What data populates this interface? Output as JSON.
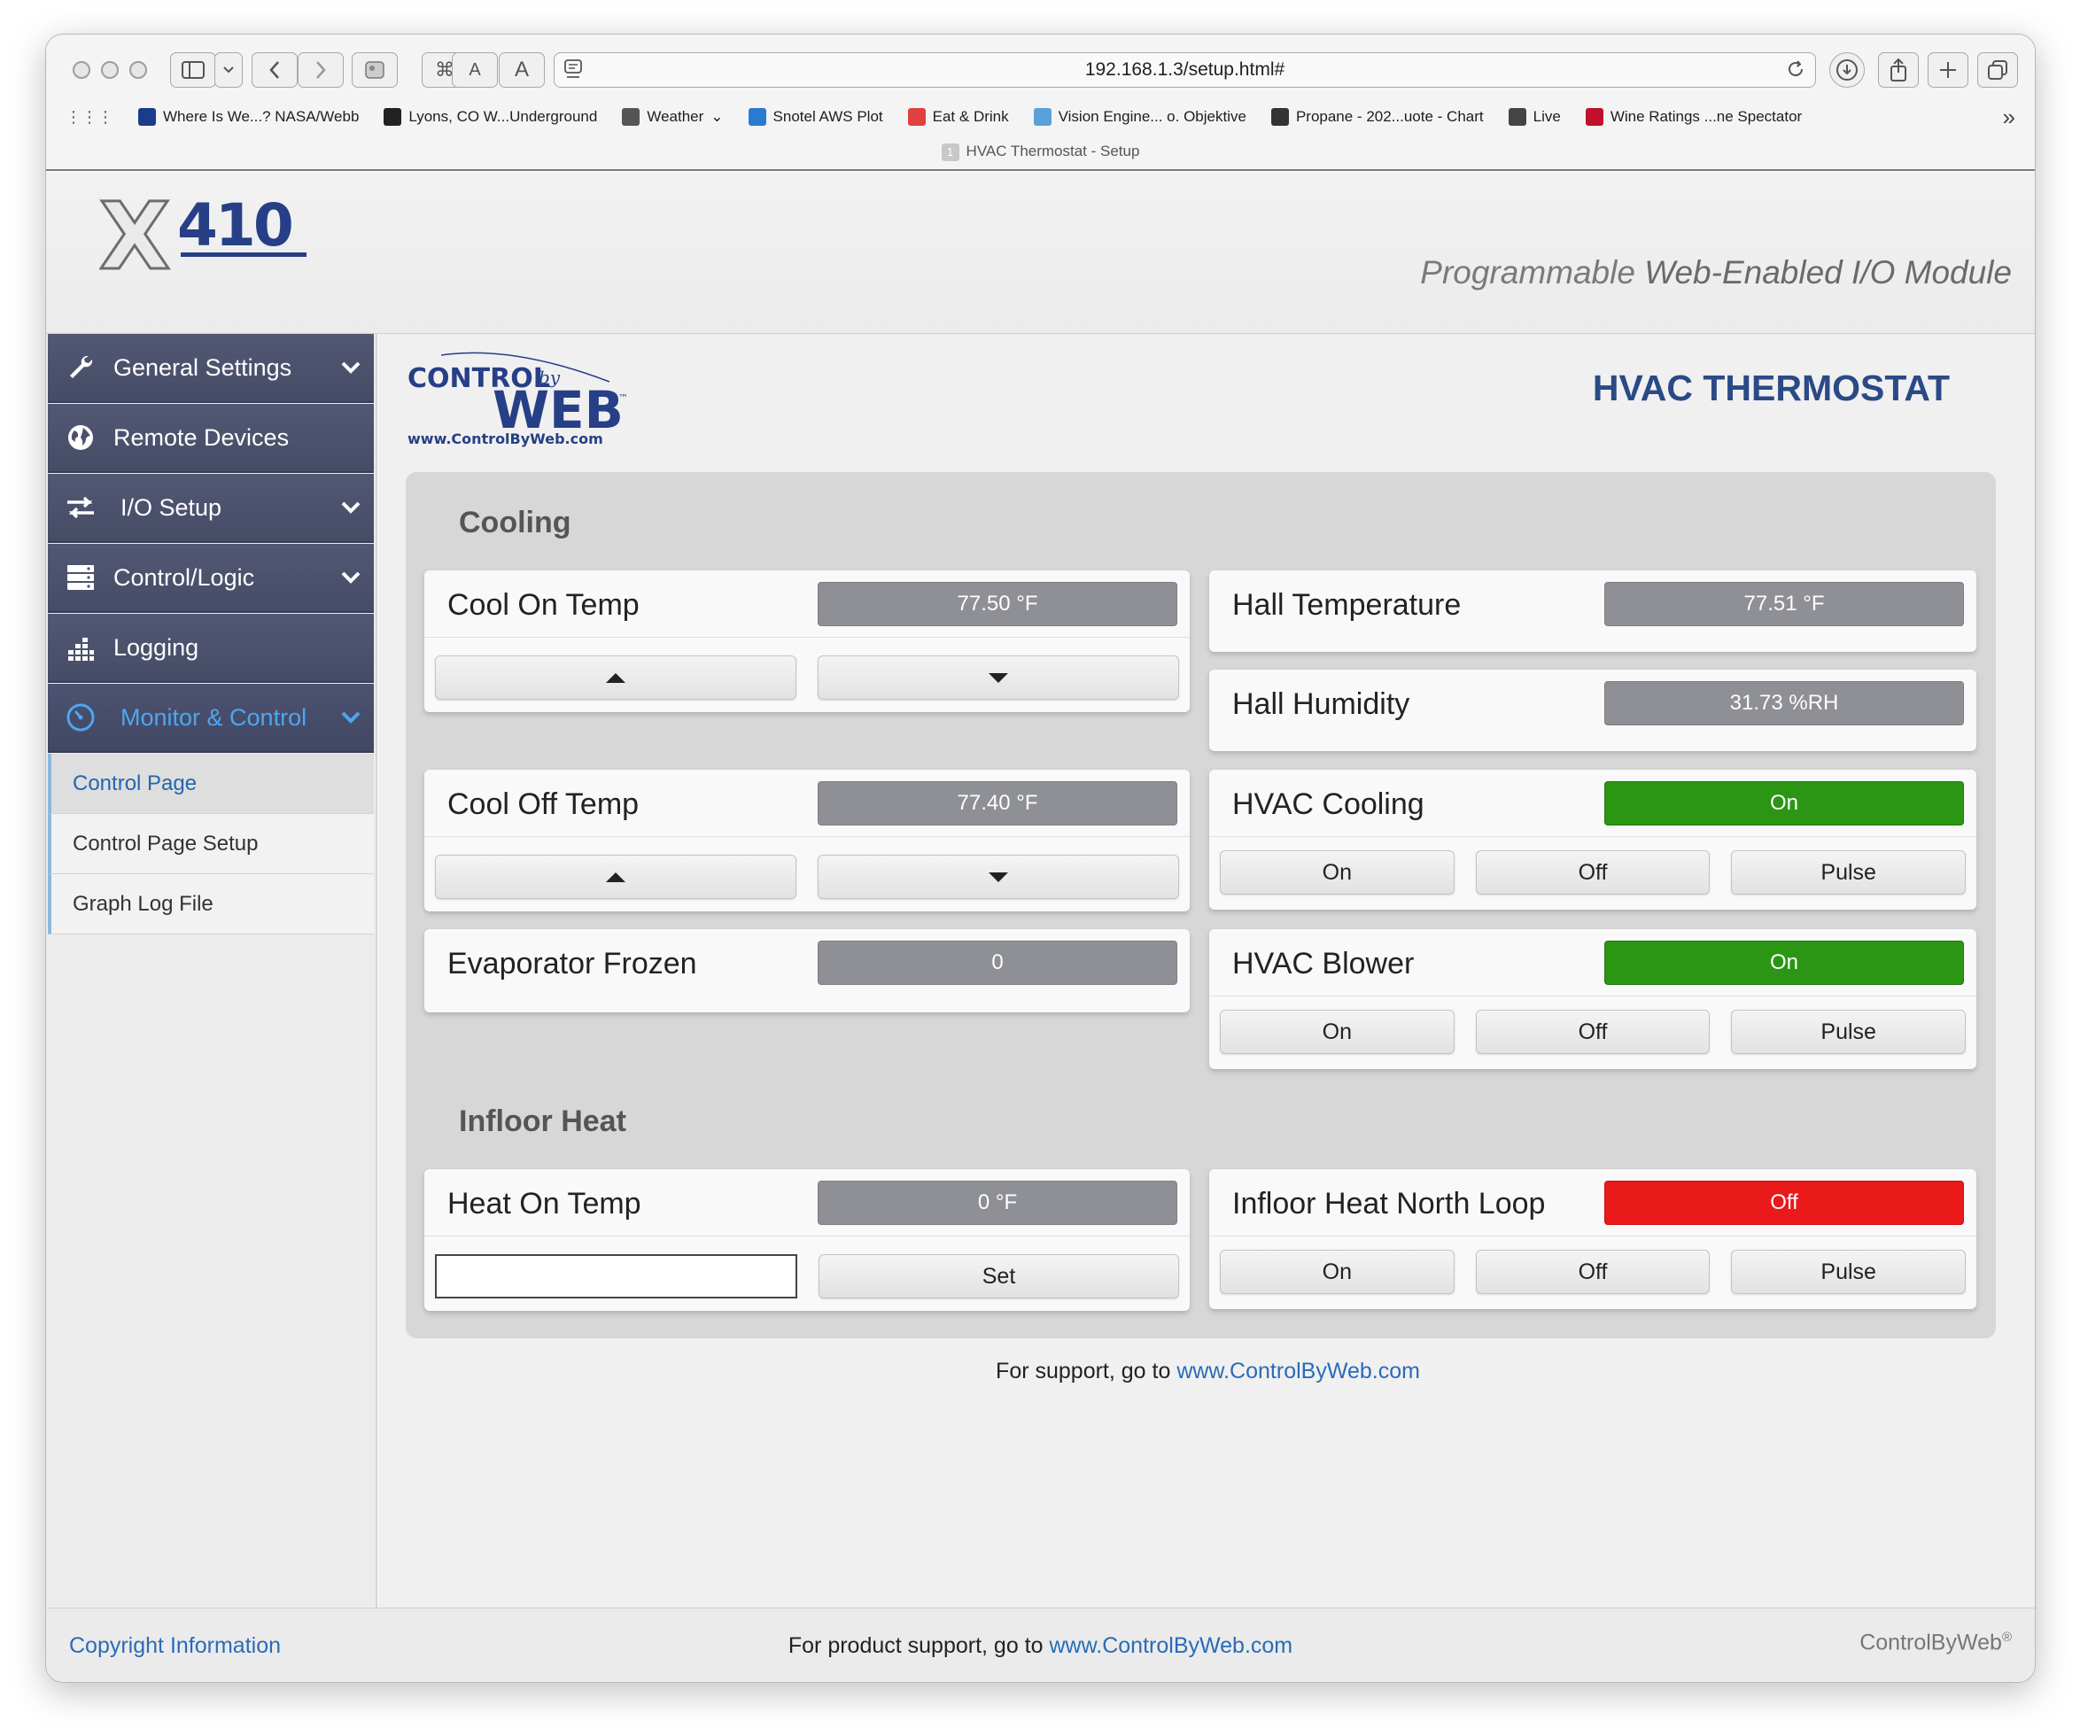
{
  "browser": {
    "url": "192.168.1.3/setup.html#",
    "tab_title": "HVAC Thermostat - Setup",
    "tab_number": "1",
    "text_size_small": "A",
    "text_size_large": "A",
    "bookmarks": [
      {
        "label": "Where Is We...? NASA/Webb",
        "icon": "nasa-icon",
        "color": "#1a3c8c"
      },
      {
        "label": "Lyons, CO W...Underground",
        "icon": "wunderground-icon",
        "color": "#222222"
      },
      {
        "label": "Weather",
        "icon": "folder-icon",
        "color": "#555555"
      },
      {
        "label": "Snotel AWS Plot",
        "icon": "water-drop-icon",
        "color": "#2a7bd0"
      },
      {
        "label": "Eat & Drink",
        "icon": "eat-drink-icon",
        "color": "#e04040"
      },
      {
        "label": "Vision Engine... o. Objektive",
        "icon": "vision-icon",
        "color": "#5aa0d8"
      },
      {
        "label": "Propane - 202...uote - Chart",
        "icon": "propane-icon",
        "color": "#333333"
      },
      {
        "label": "Live",
        "icon": "globe-icon",
        "color": "#444444"
      },
      {
        "label": "Wine Ratings ...ne Spectator",
        "icon": "ws-icon",
        "color": "#c0102a"
      }
    ]
  },
  "header": {
    "logo_text": "X410",
    "tagline_prefix": "Programmable",
    "tagline_rest": "Web-Enabled I/O Module"
  },
  "sidebar": {
    "items": [
      {
        "label": "General Settings",
        "icon": "wrench-icon",
        "expandable": true
      },
      {
        "label": "Remote Devices",
        "icon": "globe-icon",
        "expandable": false
      },
      {
        "label": "I/O Setup",
        "icon": "arrows-icon",
        "expandable": true
      },
      {
        "label": "Control/Logic",
        "icon": "server-icon",
        "expandable": true
      },
      {
        "label": "Logging",
        "icon": "bars-icon",
        "expandable": false
      },
      {
        "label": "Monitor & Control",
        "icon": "gauge-icon",
        "expandable": true,
        "active": true
      }
    ],
    "subitems": [
      {
        "label": "Control Page",
        "current": true
      },
      {
        "label": "Control Page Setup"
      },
      {
        "label": "Graph Log File"
      }
    ]
  },
  "main": {
    "brand_logo_top": "CONTROL",
    "brand_logo_by": "by",
    "brand_logo_main": "WEB",
    "brand_logo_tm": "™",
    "brand_logo_url": "www.ControlByWeb.com",
    "page_title": "HVAC THERMOSTAT",
    "sections": {
      "cooling": "Cooling",
      "infloor": "Infloor Heat"
    },
    "cards": {
      "cool_on": {
        "label": "Cool On Temp",
        "value": "77.50 °F"
      },
      "cool_off": {
        "label": "Cool Off Temp",
        "value": "77.40 °F"
      },
      "evap": {
        "label": "Evaporator Frozen",
        "value": "0"
      },
      "hall_temp": {
        "label": "Hall Temperature",
        "value": "77.51 °F"
      },
      "hall_hum": {
        "label": "Hall Humidity",
        "value": "31.73 %RH"
      },
      "hvac_cool": {
        "label": "HVAC Cooling",
        "value": "On",
        "state_color": "#2a9613"
      },
      "hvac_blower": {
        "label": "HVAC Blower",
        "value": "On",
        "state_color": "#2a9613"
      },
      "heat_on": {
        "label": "Heat On Temp",
        "value": "0 °F",
        "input_value": "",
        "set_label": "Set"
      },
      "north_loop": {
        "label": "Infloor Heat North Loop",
        "value": "Off",
        "state_color": "#ea1a1a"
      }
    },
    "relay_buttons": {
      "on": "On",
      "off": "Off",
      "pulse": "Pulse"
    },
    "support_text": "For support, go to",
    "support_link": "www.ControlByWeb.com"
  },
  "footer": {
    "copyright": "Copyright Information",
    "support_text": "For product support, go to",
    "support_link": "www.ControlByWeb.com",
    "brand": "ControlByWeb",
    "brand_mark": "®"
  }
}
